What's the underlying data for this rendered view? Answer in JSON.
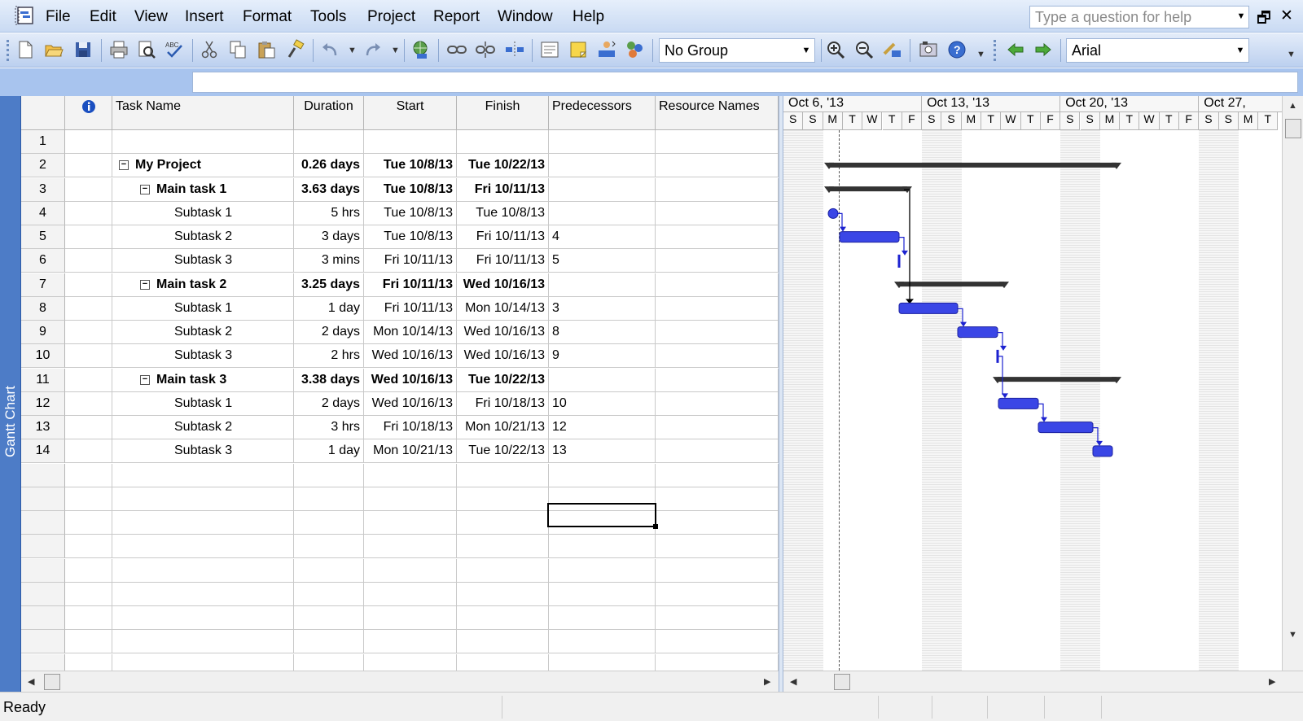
{
  "menubar": {
    "items": [
      "File",
      "Edit",
      "View",
      "Insert",
      "Format",
      "Tools",
      "Project",
      "Report",
      "Window",
      "Help"
    ],
    "help_placeholder": "Type a question for help"
  },
  "toolbar": {
    "group_value": "No Group",
    "font_value": "Arial"
  },
  "viewbar": {
    "label": "Gantt Chart"
  },
  "sheet": {
    "columns": [
      "",
      "Task Name",
      "Duration",
      "Start",
      "Finish",
      "Predecessors",
      "Resource Names"
    ],
    "rows": [
      {
        "id": "1",
        "name": "",
        "duration": "",
        "start": "",
        "finish": "",
        "pred": ""
      },
      {
        "id": "2",
        "name": "My Project",
        "duration": "0.26 days",
        "start": "Tue 10/8/13",
        "finish": "Tue 10/22/13",
        "pred": ""
      },
      {
        "id": "3",
        "name": "Main task 1",
        "duration": "3.63 days",
        "start": "Tue 10/8/13",
        "finish": "Fri 10/11/13",
        "pred": ""
      },
      {
        "id": "4",
        "name": "Subtask 1",
        "duration": "5 hrs",
        "start": "Tue 10/8/13",
        "finish": "Tue 10/8/13",
        "pred": ""
      },
      {
        "id": "5",
        "name": "Subtask 2",
        "duration": "3 days",
        "start": "Tue 10/8/13",
        "finish": "Fri 10/11/13",
        "pred": "4"
      },
      {
        "id": "6",
        "name": "Subtask 3",
        "duration": "3 mins",
        "start": "Fri 10/11/13",
        "finish": "Fri 10/11/13",
        "pred": "5"
      },
      {
        "id": "7",
        "name": "Main task 2",
        "duration": "3.25 days",
        "start": "Fri 10/11/13",
        "finish": "Wed 10/16/13",
        "pred": ""
      },
      {
        "id": "8",
        "name": "Subtask 1",
        "duration": "1 day",
        "start": "Fri 10/11/13",
        "finish": "Mon 10/14/13",
        "pred": "3"
      },
      {
        "id": "9",
        "name": "Subtask 2",
        "duration": "2 days",
        "start": "Mon 10/14/13",
        "finish": "Wed 10/16/13",
        "pred": "8"
      },
      {
        "id": "10",
        "name": "Subtask 3",
        "duration": "2 hrs",
        "start": "Wed 10/16/13",
        "finish": "Wed 10/16/13",
        "pred": "9"
      },
      {
        "id": "11",
        "name": "Main task 3",
        "duration": "3.38 days",
        "start": "Wed 10/16/13",
        "finish": "Tue 10/22/13",
        "pred": ""
      },
      {
        "id": "12",
        "name": "Subtask 1",
        "duration": "2 days",
        "start": "Wed 10/16/13",
        "finish": "Fri 10/18/13",
        "pred": "10"
      },
      {
        "id": "13",
        "name": "Subtask 2",
        "duration": "3 hrs",
        "start": "Fri 10/18/13",
        "finish": "Mon 10/21/13",
        "pred": "12"
      },
      {
        "id": "14",
        "name": "Subtask 3",
        "duration": "1 day",
        "start": "Mon 10/21/13",
        "finish": "Tue 10/22/13",
        "pred": "13"
      }
    ]
  },
  "gantt": {
    "weeks": [
      "Oct 6, '13",
      "Oct 13, '13",
      "Oct 20, '13",
      "Oct 27,"
    ],
    "days": [
      "S",
      "S",
      "M",
      "T",
      "W",
      "T",
      "F",
      "S",
      "S",
      "M",
      "T",
      "W",
      "T",
      "F",
      "S",
      "S",
      "M",
      "T",
      "W",
      "T",
      "F",
      "S",
      "S",
      "M",
      "T"
    ]
  },
  "status": {
    "text": "Ready"
  }
}
